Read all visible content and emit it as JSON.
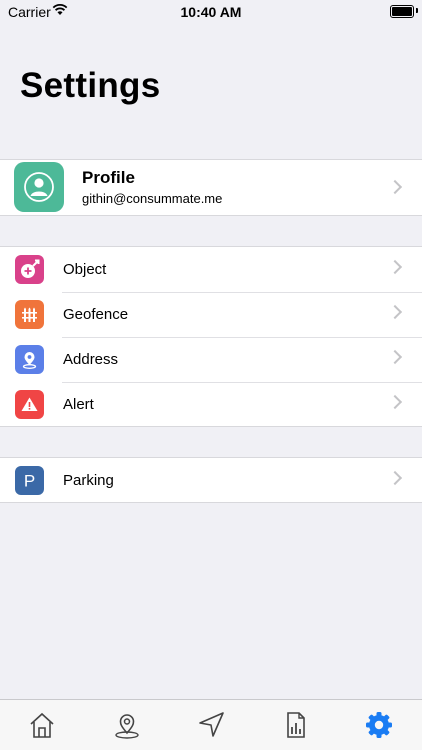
{
  "status_bar": {
    "carrier": "Carrier",
    "time": "10:40 AM"
  },
  "title": "Settings",
  "profile": {
    "name": "Profile",
    "email": "githin@consummate.me"
  },
  "menu": [
    {
      "label": "Object",
      "icon": "object-icon",
      "color": "#d9418a"
    },
    {
      "label": "Geofence",
      "icon": "fence-icon",
      "color": "#f0743b"
    },
    {
      "label": "Address",
      "icon": "location-pin-icon",
      "color": "#5b7fe8"
    },
    {
      "label": "Alert",
      "icon": "alert-triangle-icon",
      "color": "#f04545"
    }
  ],
  "extra_menu": [
    {
      "label": "Parking",
      "icon": "parking-icon",
      "color": "#3b69a7",
      "icon_text": "P"
    }
  ],
  "tabs": [
    {
      "name": "home",
      "icon": "home-icon",
      "active": false
    },
    {
      "name": "map",
      "icon": "map-pin-icon",
      "active": false
    },
    {
      "name": "navigate",
      "icon": "navigation-arrow-icon",
      "active": false
    },
    {
      "name": "reports",
      "icon": "report-chart-icon",
      "active": false
    },
    {
      "name": "settings",
      "icon": "gear-icon",
      "active": true
    }
  ],
  "colors": {
    "accent": "#1a7cf3",
    "profile_bg": "#4db998",
    "background": "#f0f0f5"
  }
}
